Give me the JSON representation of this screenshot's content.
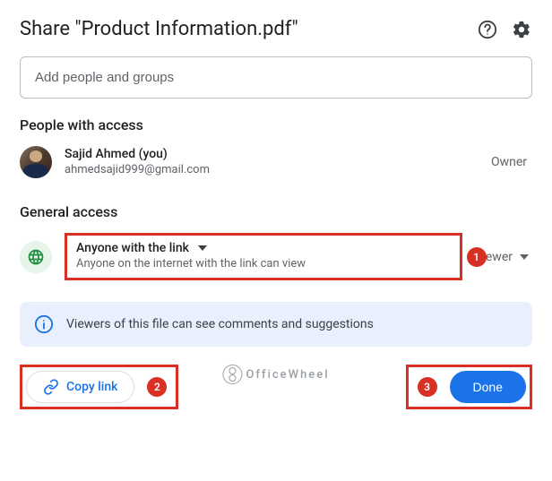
{
  "header": {
    "title": "Share \"Product Information.pdf\""
  },
  "input": {
    "placeholder": "Add people and groups"
  },
  "sections": {
    "people_title": "People with access",
    "general_title": "General access"
  },
  "owner": {
    "name": "Sajid Ahmed (you)",
    "email": "ahmedsajid999@gmail.com",
    "role": "Owner"
  },
  "general": {
    "option": "Anyone with the link",
    "description": "Anyone on the internet with the link can view",
    "role": "Viewer"
  },
  "banner": {
    "text": "Viewers of this file can see comments and suggestions"
  },
  "buttons": {
    "copy": "Copy link",
    "done": "Done"
  },
  "callouts": {
    "c1": "1",
    "c2": "2",
    "c3": "3"
  },
  "watermark": {
    "text": "OfficeWheel"
  }
}
